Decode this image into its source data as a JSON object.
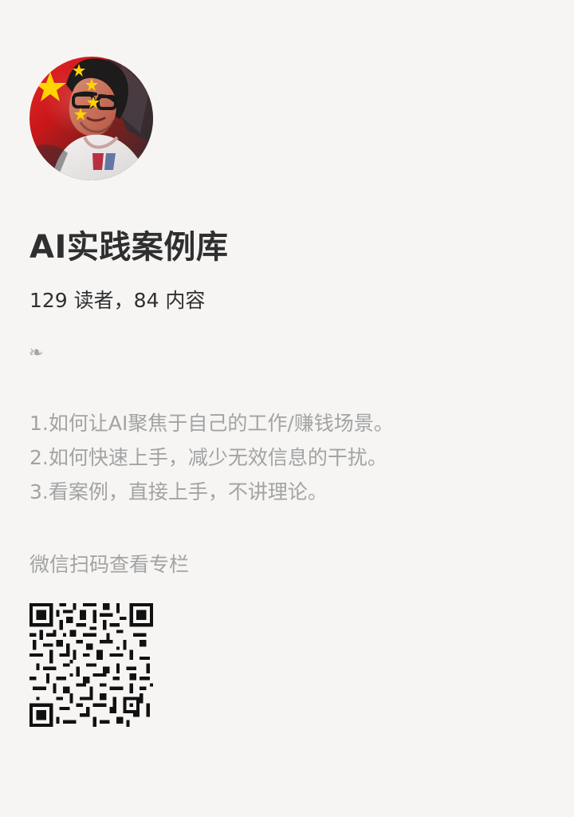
{
  "title": "AI实践案例库",
  "stats": "129 读者，84 内容",
  "ornament": "❧",
  "intro": [
    "1.如何让AI聚焦于自己的工作/赚钱场景。",
    "2.如何快速上手，减少无效信息的干扰。",
    "3.看案例，直接上手，不讲理论。"
  ],
  "qr_label": "微信扫码查看专栏",
  "colors": {
    "background": "#f6f5f4",
    "title": "#2f2f2f",
    "muted_text": "#a3a3a3",
    "flag_red": "#d71d20",
    "flag_yellow": "#ffd400"
  },
  "icons": {
    "avatar": "avatar-image",
    "ornament": "fleuron-icon",
    "qr": "qr-code-icon"
  }
}
